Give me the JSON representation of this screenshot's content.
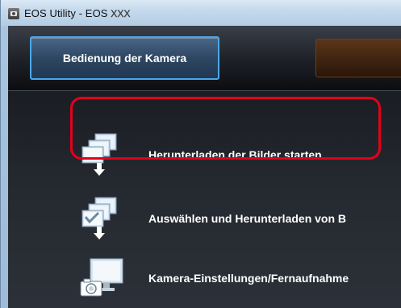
{
  "window": {
    "title": "EOS Utility - EOS",
    "model_placeholder": "XXX"
  },
  "tabs": [
    {
      "label": "Bedienung der Kamera",
      "active": true
    },
    {
      "label": "",
      "active": false
    }
  ],
  "menu": {
    "items": [
      {
        "label": "Herunterladen der Bilder starten",
        "icon": "download-images-icon",
        "highlighted": true
      },
      {
        "label": "Auswählen und Herunterladen von B",
        "icon": "select-download-icon",
        "highlighted": false
      },
      {
        "label": "Kamera-Einstellungen/Fernaufnahme",
        "icon": "camera-settings-icon",
        "highlighted": false
      }
    ]
  },
  "colors": {
    "highlight": "#e4001c",
    "tab_border": "#4aa9e8",
    "text": "#ffffff"
  }
}
